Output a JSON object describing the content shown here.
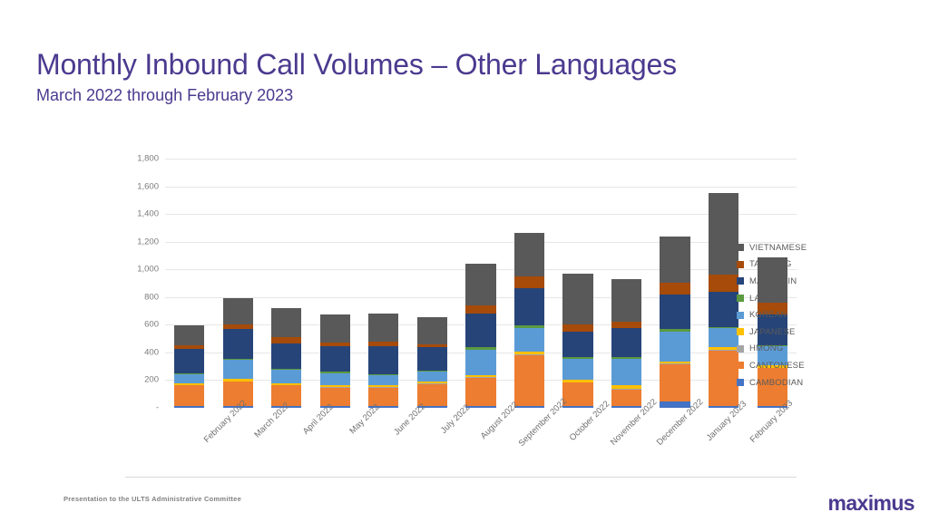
{
  "slide": {
    "title": "Monthly Inbound Call Volumes – Other Languages",
    "subtitle": "March 2022 through February 2023",
    "footer_note": "Presentation to the ULTS Administrative Committee",
    "brand": "maximus",
    "title_color": "#4B3A8F"
  },
  "chart_data": {
    "type": "bar",
    "stacked": true,
    "title": "Monthly Inbound Call Volumes – Other Languages",
    "subtitle": "March 2022 through February 2023",
    "xlabel": "",
    "ylabel": "",
    "ylim": [
      0,
      1800
    ],
    "ytick_values": [
      0,
      200,
      400,
      600,
      800,
      1000,
      1200,
      1400,
      1600,
      1800
    ],
    "ytick_labels": [
      "-",
      "200",
      "400",
      "600",
      "800",
      "1,000",
      "1,200",
      "1,400",
      "1,600",
      "1,800"
    ],
    "grid": true,
    "legend_position": "right",
    "categories": [
      "February 2022",
      "March 2022",
      "April 2022",
      "May 2022",
      "June 2022",
      "July 2022",
      "August 2022",
      "September 2022",
      "October 2022",
      "November 2022",
      "December 2022",
      "January 2023",
      "February 2023"
    ],
    "series": [
      {
        "name": "CAMBODIAN",
        "color": "#4472C4",
        "values": [
          12,
          14,
          12,
          10,
          12,
          12,
          14,
          12,
          12,
          12,
          45,
          14,
          12
        ]
      },
      {
        "name": "CANTONESE",
        "color": "#ED7D31",
        "values": [
          150,
          175,
          150,
          135,
          135,
          160,
          205,
          370,
          170,
          120,
          270,
          400,
          275
        ]
      },
      {
        "name": "HMONG",
        "color": "#A5A5A5",
        "values": [
          4,
          4,
          4,
          4,
          4,
          4,
          4,
          4,
          4,
          4,
          4,
          4,
          4
        ]
      },
      {
        "name": "JAPANESE",
        "color": "#FFC000",
        "values": [
          14,
          14,
          14,
          12,
          12,
          12,
          14,
          22,
          14,
          30,
          18,
          22,
          18
        ]
      },
      {
        "name": "KOREAN",
        "color": "#5B9BD5",
        "values": [
          65,
          140,
          95,
          90,
          70,
          75,
          180,
          170,
          155,
          185,
          215,
          135,
          135
        ]
      },
      {
        "name": "LAOTIAN",
        "color": "#5B9A41",
        "values": [
          6,
          8,
          8,
          8,
          8,
          8,
          20,
          18,
          12,
          16,
          16,
          10,
          10
        ]
      },
      {
        "name": "MANDARIN",
        "color": "#264478",
        "values": [
          175,
          215,
          185,
          185,
          205,
          170,
          245,
          270,
          180,
          210,
          250,
          250,
          220
        ]
      },
      {
        "name": "TAGALOG",
        "color": "#A64B0A",
        "values": [
          25,
          30,
          40,
          30,
          30,
          20,
          55,
          85,
          55,
          45,
          85,
          130,
          85
        ]
      },
      {
        "name": "VIETNAMESE",
        "color": "#595959",
        "values": [
          145,
          195,
          215,
          200,
          205,
          195,
          305,
          315,
          365,
          310,
          335,
          585,
          330
        ]
      }
    ],
    "totals": [
      596,
      795,
      723,
      674,
      681,
      656,
      1042,
      1266,
      967,
      932,
      1238,
      1550,
      1089
    ]
  },
  "legend": {
    "items": [
      {
        "label": "VIETNAMESE",
        "color": "#595959"
      },
      {
        "label": "TAGALOG",
        "color": "#A64B0A"
      },
      {
        "label": "MANDARIN",
        "color": "#264478"
      },
      {
        "label": "LAOTIAN",
        "color": "#5B9A41"
      },
      {
        "label": "KOREAN",
        "color": "#5B9BD5"
      },
      {
        "label": "JAPANESE",
        "color": "#FFC000"
      },
      {
        "label": "HMONG",
        "color": "#A5A5A5"
      },
      {
        "label": "CANTONESE",
        "color": "#ED7D31"
      },
      {
        "label": "CAMBODIAN",
        "color": "#4472C4"
      }
    ]
  }
}
